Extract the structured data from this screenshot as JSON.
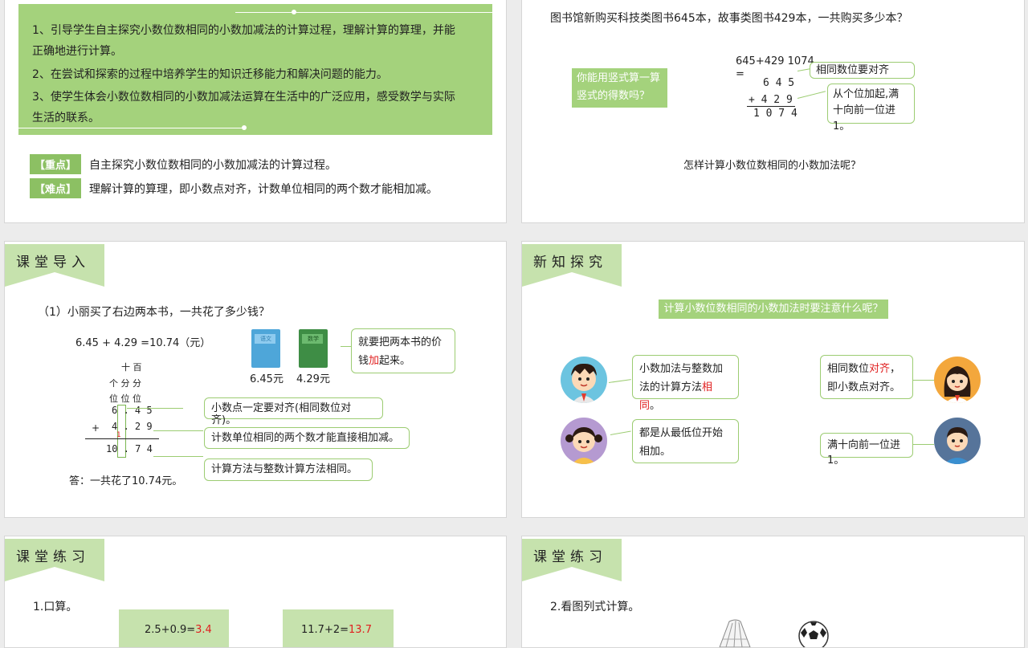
{
  "slide1": {
    "objectives": [
      "1、引导学生自主探究小数位数相同的小数加减法的计算过程，理解计算的算理，并能",
      "正确地进行计算。",
      "2、在尝试和探索的过程中培养学生的知识迁移能力和解决问题的能力。",
      "3、使学生体会小数位数相同的小数加减法运算在生活中的广泛应用，感受数学与实际",
      "生活的联系。"
    ],
    "key_tag": "【重点】",
    "key_text": "自主探究小数位数相同的小数加减法的计算过程。",
    "difficult_tag": "【难点】",
    "difficult_text": "理解计算的算理，即小数点对齐，计数单位相同的两个数才能相加减。"
  },
  "slide2": {
    "question": "图书馆新购买科技类图书645本，故事类图书429本，一共购买多少本？",
    "prompt_line1": "你能用竖式算一算",
    "prompt_line2": "竖式的得数吗？",
    "equation": "645+429 1074",
    "equals": "=",
    "row1": "6 4 5",
    "row2": "+ 4 2 9",
    "row3": "1 0 7 4",
    "bubble1": "相同数位要对齐",
    "bubble2_line1": "从个位加起,满",
    "bubble2_line2": "十向前一位进1。",
    "bottom_question": "怎样计算小数位数相同的小数加法呢？"
  },
  "slide3": {
    "header": "课堂导入",
    "question": "（1）小丽买了右边两本书，一共花了多少钱？",
    "equation": "6.45 + 4.29 =10.74（元）",
    "book1_label": "语文",
    "book1_price": "6.45元",
    "book2_label": "数学",
    "book2_price": "4.29元",
    "bubble_top_pre": "就要把两本书的价",
    "bubble_top_line2_a": "钱",
    "bubble_top_line2_red": "加",
    "bubble_top_line2_b": "起来。",
    "place_shi_bai": "十 百",
    "place_fen": "个 分 分",
    "place_wei": "位 位 位",
    "row1": "6 . 4  5",
    "plus": "+",
    "row2": "4 . 2  9",
    "carry": "1",
    "row3": "10 . 7  4",
    "note1": "小数点一定要对齐(相同数位对齐)。",
    "note2": "计数单位相同的两个数才能直接相加减。",
    "note3": "计算方法与整数计算方法相同。",
    "answer": "答：一共花了10.74元。"
  },
  "slide4": {
    "header": "新知探究",
    "banner": "计算小数位数相同的小数加法时要注意什么呢？",
    "b1_line1": "小数加法与整数加",
    "b1_line2a": "法的计算方法",
    "b1_line2red": "相同",
    "b1_line2b": "。",
    "b2_line1": "都是从最低位开始",
    "b2_line2": "相加。",
    "b3_line1a": "相同数位",
    "b3_line1red": "对齐",
    "b3_line1b": "，",
    "b3_line2": "即小数点对齐。",
    "b4": "满十向前一位进1。"
  },
  "slide5": {
    "header": "课堂练习",
    "title": "1.口算。",
    "q1": "2.5+0.9=",
    "a1": "3.4",
    "q2": "11.7+2=",
    "a2": "13.7"
  },
  "slide6": {
    "header": "课堂练习",
    "title": "2.看图列式计算。"
  },
  "colors": {
    "accent_green": "#a4d27c",
    "tab_green": "#c6e2ad",
    "answer_red": "#e02020"
  }
}
